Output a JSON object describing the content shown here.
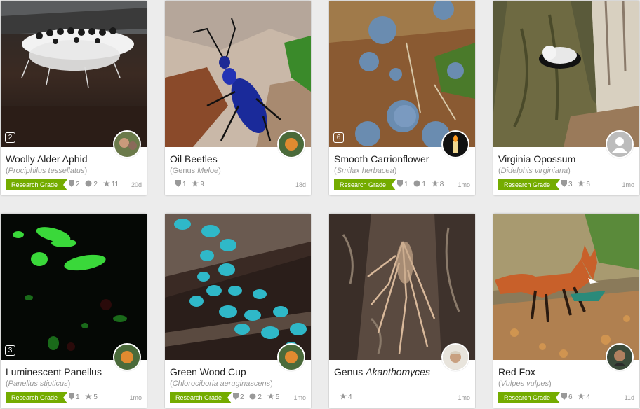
{
  "cards": [
    {
      "title": "Woolly Alder Aphid",
      "sci": "Prociphilus tessellatus",
      "sci_prefix": "",
      "badge": "2",
      "grade": "Research Grade",
      "ids": "2",
      "comments": "2",
      "faves": "11",
      "age": "20d"
    },
    {
      "title": "Oil Beetles",
      "sci": "Meloe",
      "sci_prefix": "Genus ",
      "badge": "",
      "grade": "",
      "ids": "1",
      "comments": "",
      "faves": "9",
      "age": "18d"
    },
    {
      "title": "Smooth Carrionflower",
      "sci": "Smilax herbacea",
      "sci_prefix": "",
      "badge": "6",
      "grade": "Research Grade",
      "ids": "1",
      "comments": "1",
      "faves": "8",
      "age": "1mo"
    },
    {
      "title": "Virginia Opossum",
      "sci": "Didelphis virginiana",
      "sci_prefix": "",
      "badge": "",
      "grade": "Research Grade",
      "ids": "3",
      "comments": "",
      "faves": "6",
      "age": "1mo"
    },
    {
      "title": "Luminescent Panellus",
      "sci": "Panellus stipticus",
      "sci_prefix": "",
      "badge": "3",
      "grade": "Research Grade",
      "ids": "1",
      "comments": "",
      "faves": "5",
      "age": "1mo"
    },
    {
      "title": "Green Wood Cup",
      "sci": "Chlorociboria aeruginascens",
      "sci_prefix": "",
      "badge": "",
      "grade": "Research Grade",
      "ids": "2",
      "comments": "2",
      "faves": "5",
      "age": "1mo"
    },
    {
      "title_prefix": "Genus ",
      "title": "Akanthomyces",
      "sci": "",
      "sci_prefix": "",
      "badge": "",
      "grade": "",
      "ids": "",
      "comments": "",
      "faves": "4",
      "age": "1mo"
    },
    {
      "title": "Red Fox",
      "sci": "Vulpes vulpes",
      "sci_prefix": "",
      "badge": "",
      "grade": "Research Grade",
      "ids": "6",
      "comments": "",
      "faves": "4",
      "age": "11d"
    }
  ],
  "icons": {
    "ids": "shield-icon",
    "comments": "speech-bubble-icon",
    "faves": "star-icon"
  },
  "colors": {
    "research_grade": "#74ac00",
    "background": "#ececec"
  }
}
